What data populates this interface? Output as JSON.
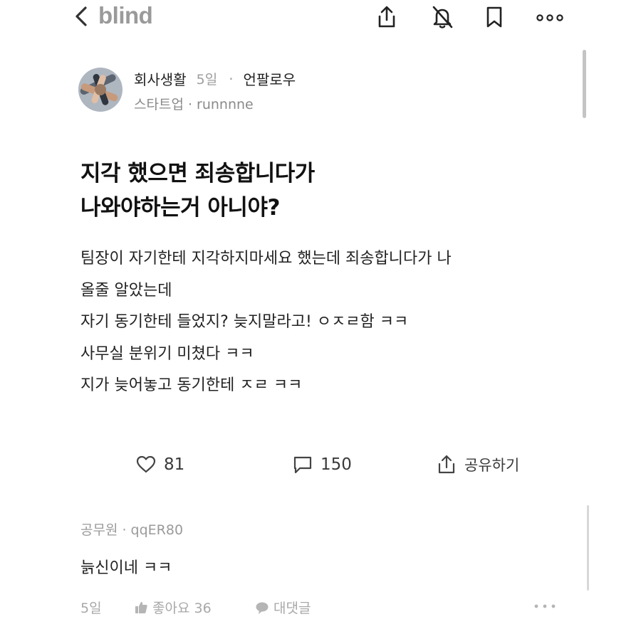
{
  "header": {
    "logo": "blind",
    "icons": [
      "back-chevron-icon",
      "share-icon",
      "bell-off-icon",
      "bookmark-icon",
      "more-icon"
    ]
  },
  "post": {
    "board": "회사생활",
    "time": "5일",
    "separator": "·",
    "follow_label": "언팔로우",
    "author_line": "스타트업 · runnnne",
    "title_lines": [
      "지각 했으면 죄송합니다가",
      "나와야하는거 아니야?"
    ],
    "body_lines": [
      "팀장이 자기한테 지각하지마세요 했는데 죄송합니다가 나",
      "올줄 알았는데",
      "자기 동기한테 들었지? 늦지말라고! ㅇㅈㄹ함 ㅋㅋ",
      "사무실 분위기 미쳤다 ㅋㅋ",
      "지가 늦어놓고 동기한테 ㅈㄹ ㅋㅋ"
    ]
  },
  "actions": {
    "like_count": "81",
    "comment_count": "150",
    "share_label": "공유하기"
  },
  "comment": {
    "author_line": "공무원 · qqER80",
    "text": "늙신이네 ㅋㅋ",
    "time": "5일",
    "like_label": "좋아요 36",
    "reply_label": "대댓글"
  },
  "colors": {
    "logo_gray": "#9a9a9a",
    "meta_gray": "#9e9e9e",
    "text_dark": "#1a1a1a"
  }
}
